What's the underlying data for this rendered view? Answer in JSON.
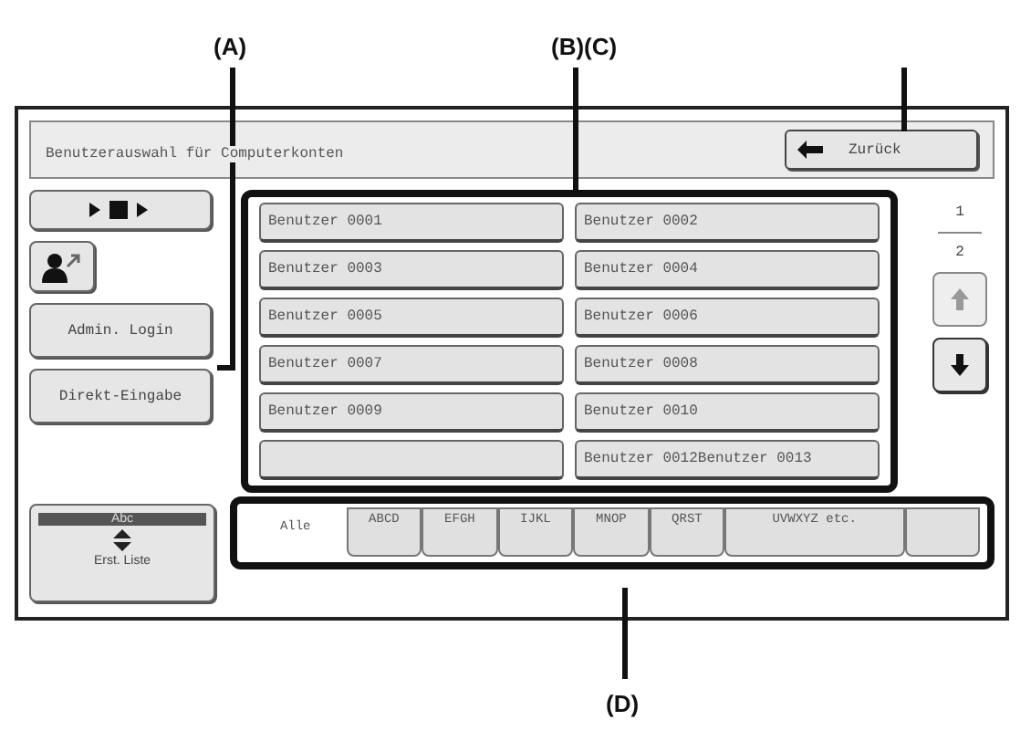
{
  "callouts": [
    {
      "label": "(A)"
    },
    {
      "label": "(B)(C)"
    },
    {
      "label": "(D)"
    }
  ],
  "screen": {
    "title": "Benutzerauswahl für Computerkonten",
    "back_button": "Zurück",
    "side_buttons": [
      {
        "kind": "icon-tray"
      },
      {
        "kind": "icon-user"
      },
      {
        "kind": "text",
        "label": "Admin. Login"
      },
      {
        "kind": "text",
        "label": "Direkt-Eingabe"
      }
    ],
    "users": [
      {
        "kind": "user",
        "name": "Benutzer 0001"
      },
      {
        "kind": "user",
        "name": "Benutzer 0002"
      },
      {
        "kind": "user",
        "name": "Benutzer 0003"
      },
      {
        "kind": "user",
        "name": "Benutzer 0004"
      },
      {
        "kind": "user",
        "name": "Benutzer 0005"
      },
      {
        "kind": "user",
        "name": "Benutzer 0006"
      },
      {
        "kind": "user",
        "name": "Benutzer 0007"
      },
      {
        "kind": "user",
        "name": "Benutzer 0008"
      },
      {
        "kind": "user",
        "name": "Benutzer 0009"
      },
      {
        "kind": "user",
        "name": "Benutzer 0010"
      },
      {
        "kind": "blank"
      },
      {
        "kind": "user",
        "name": "Benutzer 0012Benutzer 0013"
      }
    ],
    "page": {
      "current": "1",
      "total": "2"
    },
    "sort_button": {
      "header": "Abc",
      "label": "Erst. Liste"
    },
    "tabs": [
      {
        "label": "Alle",
        "selected": true
      },
      {
        "label": "ABCD",
        "selected": false
      },
      {
        "label": "EFGH",
        "selected": false
      },
      {
        "label": "IJKL",
        "selected": false
      },
      {
        "label": "MNOP",
        "selected": false
      },
      {
        "label": "QRST",
        "selected": false
      },
      {
        "label": "UVWXYZ etc.",
        "selected": false
      },
      {
        "selected": false
      }
    ]
  }
}
